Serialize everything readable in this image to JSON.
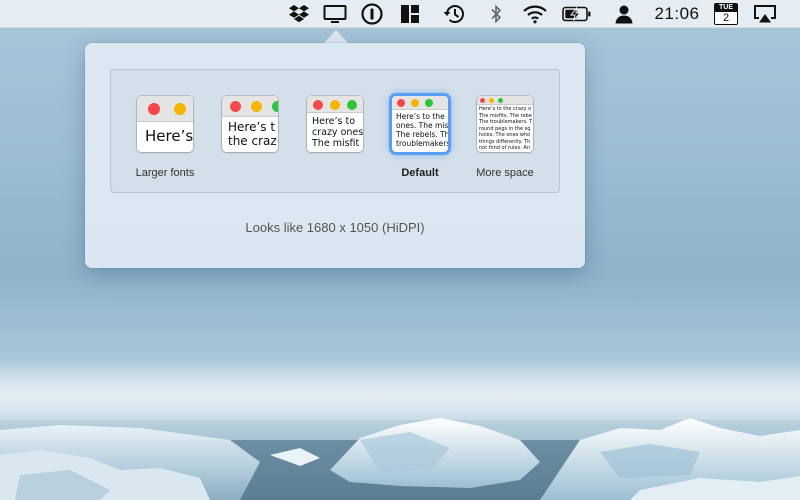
{
  "menubar": {
    "icons": [
      "dropbox-icon",
      "display-icon",
      "1password-icon",
      "window-layout-icon",
      "time-machine-icon",
      "bluetooth-icon",
      "wifi-icon",
      "battery-charging-icon",
      "user-icon",
      "calendar-icon",
      "airplay-icon"
    ],
    "clock": "21:06",
    "calendar_day": "TUE",
    "calendar_date": "2"
  },
  "display_popover": {
    "options": [
      {
        "id": "larger-fonts",
        "preview_text": [
          "Here’s"
        ],
        "label": "Larger fonts",
        "selected": false
      },
      {
        "id": "scale-2",
        "preview_text": [
          "Here’s t",
          "the craz"
        ],
        "label": "",
        "selected": false
      },
      {
        "id": "scale-3",
        "preview_text": [
          "Here’s to",
          "crazy ones",
          "The misfit"
        ],
        "label": "",
        "selected": false
      },
      {
        "id": "default",
        "preview_text": [
          "Here’s to the",
          "ones. The mis",
          "The rebels. Th",
          "troublemakers"
        ],
        "label": "Default",
        "selected": true
      },
      {
        "id": "more-space",
        "preview_text": [
          "Here’s to the crazy o",
          "The misfits. The rebe",
          "The troublemakers. T",
          "round pegs in the sq",
          "holes. The ones who",
          "things differently. Th",
          "not fond of rules. An"
        ],
        "label": "More space",
        "selected": false
      }
    ],
    "resolution_text": "Looks like 1680 x 1050 (HiDPI)"
  },
  "colors": {
    "dot_red": "#f5484a",
    "dot_yellow": "#f4b400",
    "dot_green": "#2cc43c",
    "selection_ring": "#5aa0f2"
  }
}
